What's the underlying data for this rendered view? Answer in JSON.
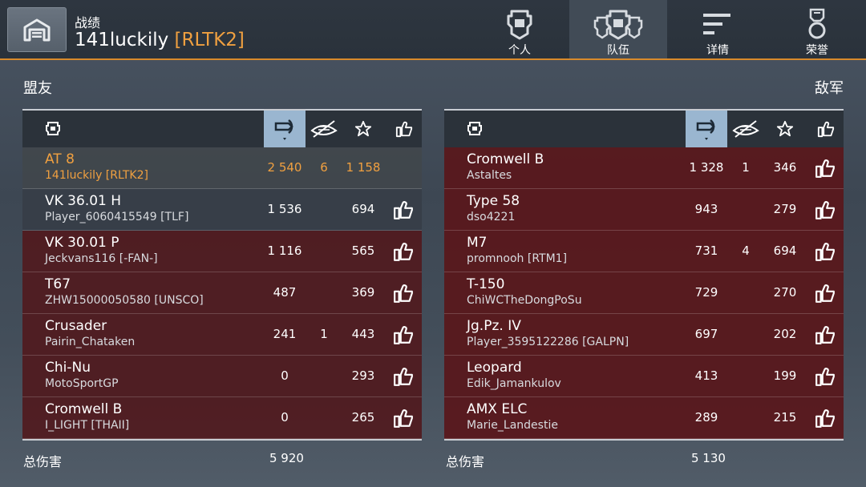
{
  "header": {
    "section": "战绩",
    "player": "141luckily",
    "clan": "[RLTK2]",
    "accent": "#d98a2b"
  },
  "nav": [
    {
      "label": "个人",
      "icon": "tank-helmet-icon",
      "active": false
    },
    {
      "label": "队伍",
      "icon": "team-icon",
      "active": true
    },
    {
      "label": "详情",
      "icon": "details-lines-icon",
      "active": false
    },
    {
      "label": "荣誉",
      "icon": "medal-icon",
      "active": false
    }
  ],
  "allies": {
    "title": "盟友",
    "rows": [
      {
        "tank": "AT 8",
        "player": "141luckily [RLTK2]",
        "damage": "2 540",
        "kills": "6",
        "score": "1 158",
        "self": true
      },
      {
        "tank": "VK 36.01 H",
        "player": "Player_6060415549 [TLF]",
        "damage": "1 536",
        "kills": "",
        "score": "694"
      },
      {
        "tank": "VK 30.01 P",
        "player": "Jeckvans116 [-FAN-]",
        "damage": "1 116",
        "kills": "",
        "score": "565"
      },
      {
        "tank": "T67",
        "player": "ZHW15000050580 [UNSCO]",
        "damage": "487",
        "kills": "",
        "score": "369"
      },
      {
        "tank": "Crusader",
        "player": "Pairin_Chataken",
        "damage": "241",
        "kills": "1",
        "score": "443"
      },
      {
        "tank": "Chi-Nu",
        "player": "MotoSportGP",
        "damage": "0",
        "kills": "",
        "score": "293"
      },
      {
        "tank": "Cromwell B",
        "player": "I_LIGHT [THAII]",
        "damage": "0",
        "kills": "",
        "score": "265"
      }
    ],
    "total_label": "总伤害",
    "total": "5 920"
  },
  "enemies": {
    "title": "敌军",
    "rows": [
      {
        "tank": "Cromwell B",
        "player": "Astaltes",
        "damage": "1 328",
        "kills": "1",
        "score": "346"
      },
      {
        "tank": "Type 58",
        "player": "dso4221",
        "damage": "943",
        "kills": "",
        "score": "279"
      },
      {
        "tank": "M7",
        "player": "promnooh [RTM1]",
        "damage": "731",
        "kills": "4",
        "score": "694"
      },
      {
        "tank": "T-150",
        "player": "ChiWCTheDongPoSu",
        "damage": "729",
        "kills": "",
        "score": "270"
      },
      {
        "tank": "Jg.Pz. IV",
        "player": "Player_3595122286 [GALPN]",
        "damage": "697",
        "kills": "",
        "score": "202"
      },
      {
        "tank": "Leopard",
        "player": "Edik_Jamankulov",
        "damage": "413",
        "kills": "",
        "score": "199"
      },
      {
        "tank": "AMX ELC",
        "player": "Marie_Landestie",
        "damage": "289",
        "kills": "",
        "score": "215"
      }
    ],
    "total_label": "总伤害",
    "total": "5 130"
  },
  "columns": [
    "tank-column-icon",
    "damage-icon",
    "kills-icon",
    "star-icon",
    "like-icon"
  ]
}
